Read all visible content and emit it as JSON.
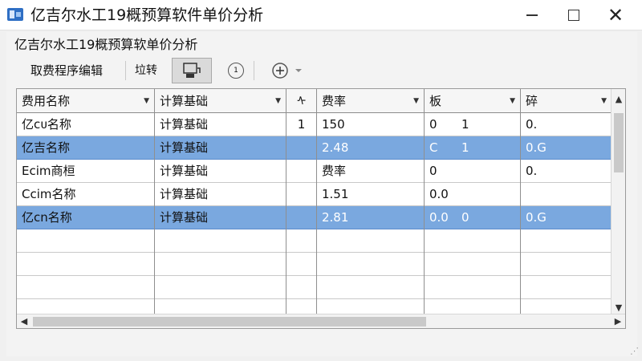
{
  "window": {
    "title": "亿吉尔水工19概预算软件单价分析",
    "app_icon": "app-icon"
  },
  "panel": {
    "title": "亿吉尔水工19概预算软单价分析"
  },
  "toolbar": {
    "label": "取费程序编辑",
    "button_text": "垃转",
    "pressed_icon": "printer-icon",
    "clock_icon": "clock-icon",
    "add_icon": "plus-icon",
    "dropdown_icon": "chevron-down-icon"
  },
  "grid": {
    "columns": [
      "费用名称",
      "计算基础",
      "ᠰ",
      "费率",
      "板",
      "碎"
    ],
    "rows": [
      [
        "亿ᴄᴜ名称",
        "计算基础",
        "1",
        "150",
        "0",
        "0."
      ],
      [
        "亿吉名称",
        "计算基础",
        "",
        "2.48",
        "C",
        "0.G"
      ],
      [
        "Ecim商桓",
        "计算基础",
        "",
        "费率",
        "0",
        "0."
      ],
      [
        "Ccim名称",
        "计算基础",
        "",
        "1.51",
        "0.0",
        ""
      ],
      [
        "亿cn名称",
        "计算基础",
        "",
        "2.81",
        "0.0",
        "0.G"
      ]
    ],
    "extra_values": [
      "1",
      "1",
      "",
      "",
      "0"
    ],
    "selected_rows": [
      1,
      4
    ]
  },
  "colors": {
    "selection": "#7aa8df",
    "background": "#f0f0f0"
  }
}
